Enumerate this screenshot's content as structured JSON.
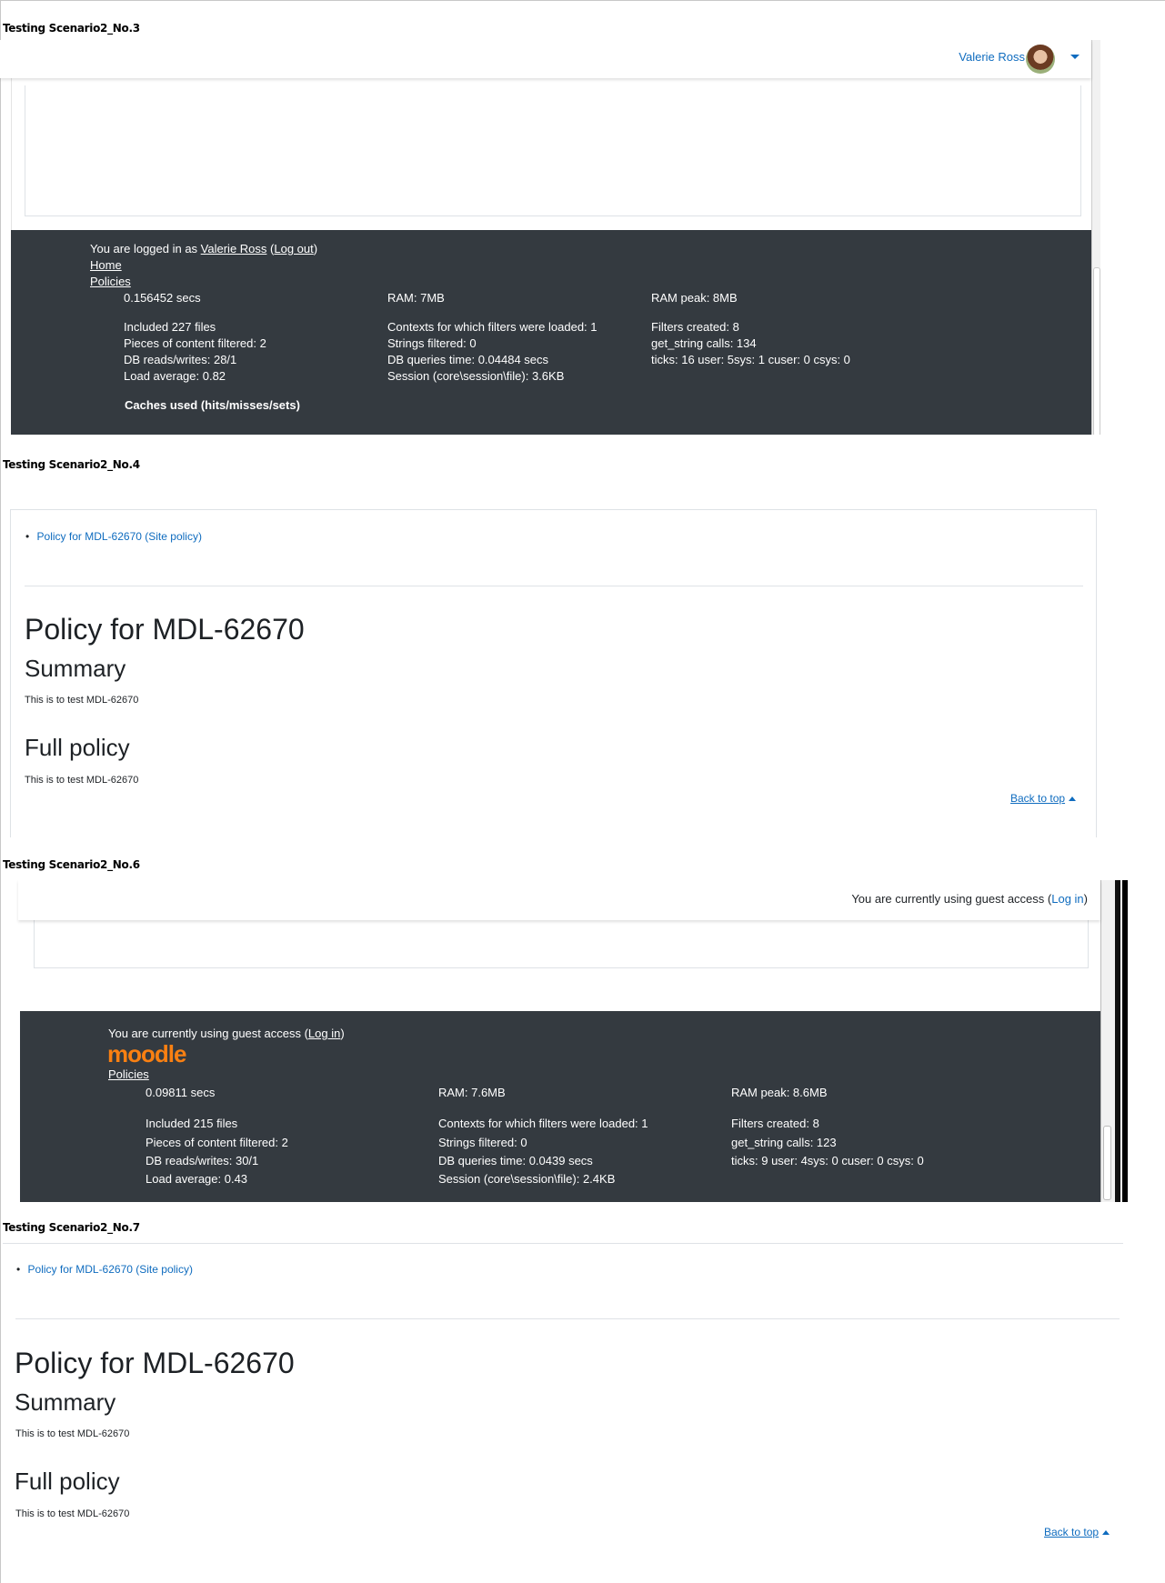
{
  "scenarios": {
    "s3": {
      "title": "Testing Scenario2_No.3",
      "user_name": "Valerie Ross",
      "footer": {
        "logged_in_prefix": "You are logged in as ",
        "user_link": "Valerie Ross",
        "open_paren": " (",
        "logout": "Log out",
        "close_paren": ")",
        "home": "Home",
        "policies": "Policies",
        "perf": {
          "time": "0.156452 secs",
          "ram": "RAM: 7MB",
          "ram_peak": "RAM peak: 8MB",
          "included": "Included 227 files",
          "contexts": "Contexts for which filters were loaded: 1",
          "filters_created": "Filters created: 8",
          "pieces": "Pieces of content filtered: 2",
          "strings": "Strings filtered: 0",
          "get_string": "get_string calls: 134",
          "db_rw": "DB reads/writes: 28/1",
          "db_time": "DB queries time: 0.04484 secs",
          "ticks": "ticks: 16 user: 5sys: 1 cuser: 0 csys: 0",
          "load": "Load average: 0.82",
          "session": "Session (core\\session\\file): 3.6KB"
        },
        "caches_heading": "Caches used (hits/misses/sets)"
      }
    },
    "s4": {
      "title": "Testing Scenario2_No.4",
      "policy_link": "Policy for MDL-62670 (Site policy)",
      "heading": "Policy for MDL-62670",
      "summary_heading": "Summary",
      "summary_text": "This is to test MDL-62670",
      "full_heading": "Full policy",
      "full_text": "This is to test MDL-62670",
      "back_to_top": "Back to top"
    },
    "s6": {
      "title": "Testing Scenario2_No.6",
      "guest_prefix": "You are currently using guest access (",
      "login": "Log in",
      "guest_suffix": ")",
      "footer": {
        "guest_prefix": "You are currently using guest access (",
        "login": "Log in",
        "guest_suffix": ")",
        "logo_text": "moodle",
        "policies": "Policies",
        "perf": {
          "time": "0.09811 secs",
          "ram": "RAM: 7.6MB",
          "ram_peak": "RAM peak: 8.6MB",
          "included": "Included 215 files",
          "contexts": "Contexts for which filters were loaded: 1",
          "filters_created": "Filters created: 8",
          "pieces": "Pieces of content filtered: 2",
          "strings": "Strings filtered: 0",
          "get_string": "get_string calls: 123",
          "db_rw": "DB reads/writes: 30/1",
          "db_time": "DB queries time: 0.0439 secs",
          "ticks": "ticks: 9 user: 4sys: 0 cuser: 0 csys: 0",
          "load": "Load average: 0.43",
          "session": "Session (core\\session\\file): 2.4KB"
        }
      }
    },
    "s7": {
      "title": "Testing Scenario2_No.7",
      "policy_link": "Policy for MDL-62670 (Site policy)",
      "heading": "Policy for MDL-62670",
      "summary_heading": "Summary",
      "summary_text": "This is to test MDL-62670",
      "full_heading": "Full policy",
      "full_text": "This is to test MDL-62670",
      "back_to_top": "Back to top"
    }
  },
  "colors": {
    "link": "#0f6cbf",
    "footer_bg": "#343a40",
    "moodle_orange": "#f98012"
  }
}
